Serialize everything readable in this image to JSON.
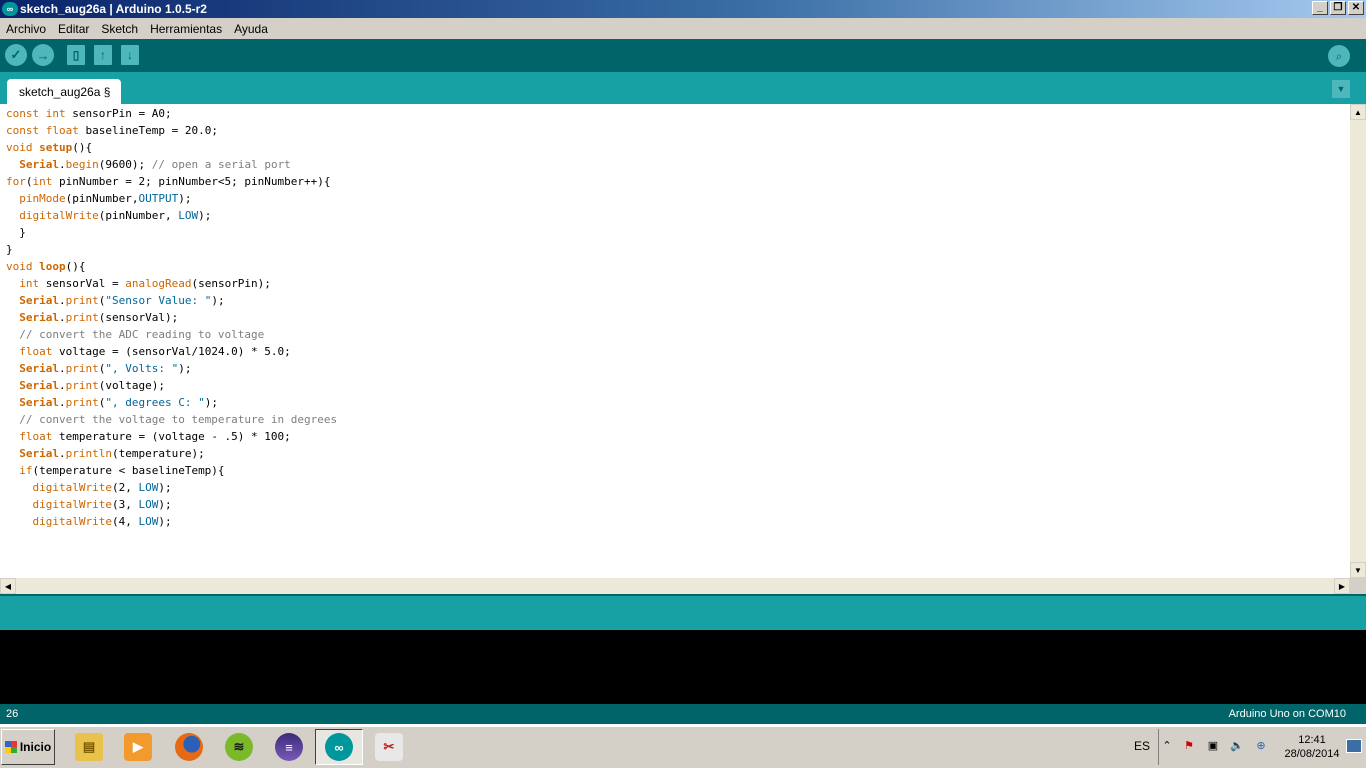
{
  "window": {
    "title": "sketch_aug26a | Arduino 1.0.5-r2",
    "app_icon": "arduino-logo-icon",
    "controls": [
      "minimize-icon",
      "restore-icon",
      "close-icon"
    ]
  },
  "menu": [
    "Archivo",
    "Editar",
    "Sketch",
    "Herramientas",
    "Ayuda"
  ],
  "toolbar": {
    "buttons": [
      "verify-icon",
      "upload-icon",
      "new-icon",
      "open-icon",
      "save-icon"
    ],
    "serial_monitor": "serial-monitor-icon"
  },
  "tabs": [
    {
      "label": "sketch_aug26a §"
    }
  ],
  "editor": {
    "lines": [
      "const int sensorPin = A0;",
      "const float baselineTemp = 20.0;",
      "void setup(){",
      "  Serial.begin(9600); // open a serial port",
      "for(int pinNumber = 2; pinNumber<5; pinNumber++){",
      "  pinMode(pinNumber,OUTPUT);",
      "  digitalWrite(pinNumber, LOW);",
      "  }",
      "}",
      "void loop(){",
      "  int sensorVal = analogRead(sensorPin);",
      "  Serial.print(\"Sensor Value: \");",
      "  Serial.print(sensorVal);",
      "  // convert the ADC reading to voltage",
      "  float voltage = (sensorVal/1024.0) * 5.0;",
      "  Serial.print(\", Volts: \");",
      "  Serial.print(voltage);",
      "  Serial.print(\", degrees C: \");",
      "  // convert the voltage to temperature in degrees",
      "  float temperature = (voltage - .5) * 100;",
      "  Serial.println(temperature);",
      "  if(temperature < baselineTemp){",
      "    digitalWrite(2, LOW);",
      "    digitalWrite(3, LOW);",
      "    digitalWrite(4, LOW);"
    ]
  },
  "footer": {
    "line_number": "26",
    "board": "Arduino Uno on COM10"
  },
  "taskbar": {
    "start_label": "Inicio",
    "apps": [
      "file-explorer-icon",
      "media-player-icon",
      "firefox-icon",
      "spotify-icon",
      "eclipse-icon",
      "arduino-icon",
      "snipping-tool-icon"
    ],
    "active_app": "arduino-icon",
    "language": "ES",
    "time": "12:41",
    "date": "28/08/2014"
  },
  "colors": {
    "toolbar": "#006468",
    "tabs_bar": "#17a1a5",
    "keyword": "#cc6600",
    "constant": "#006699",
    "comment": "#7e7e7e"
  }
}
